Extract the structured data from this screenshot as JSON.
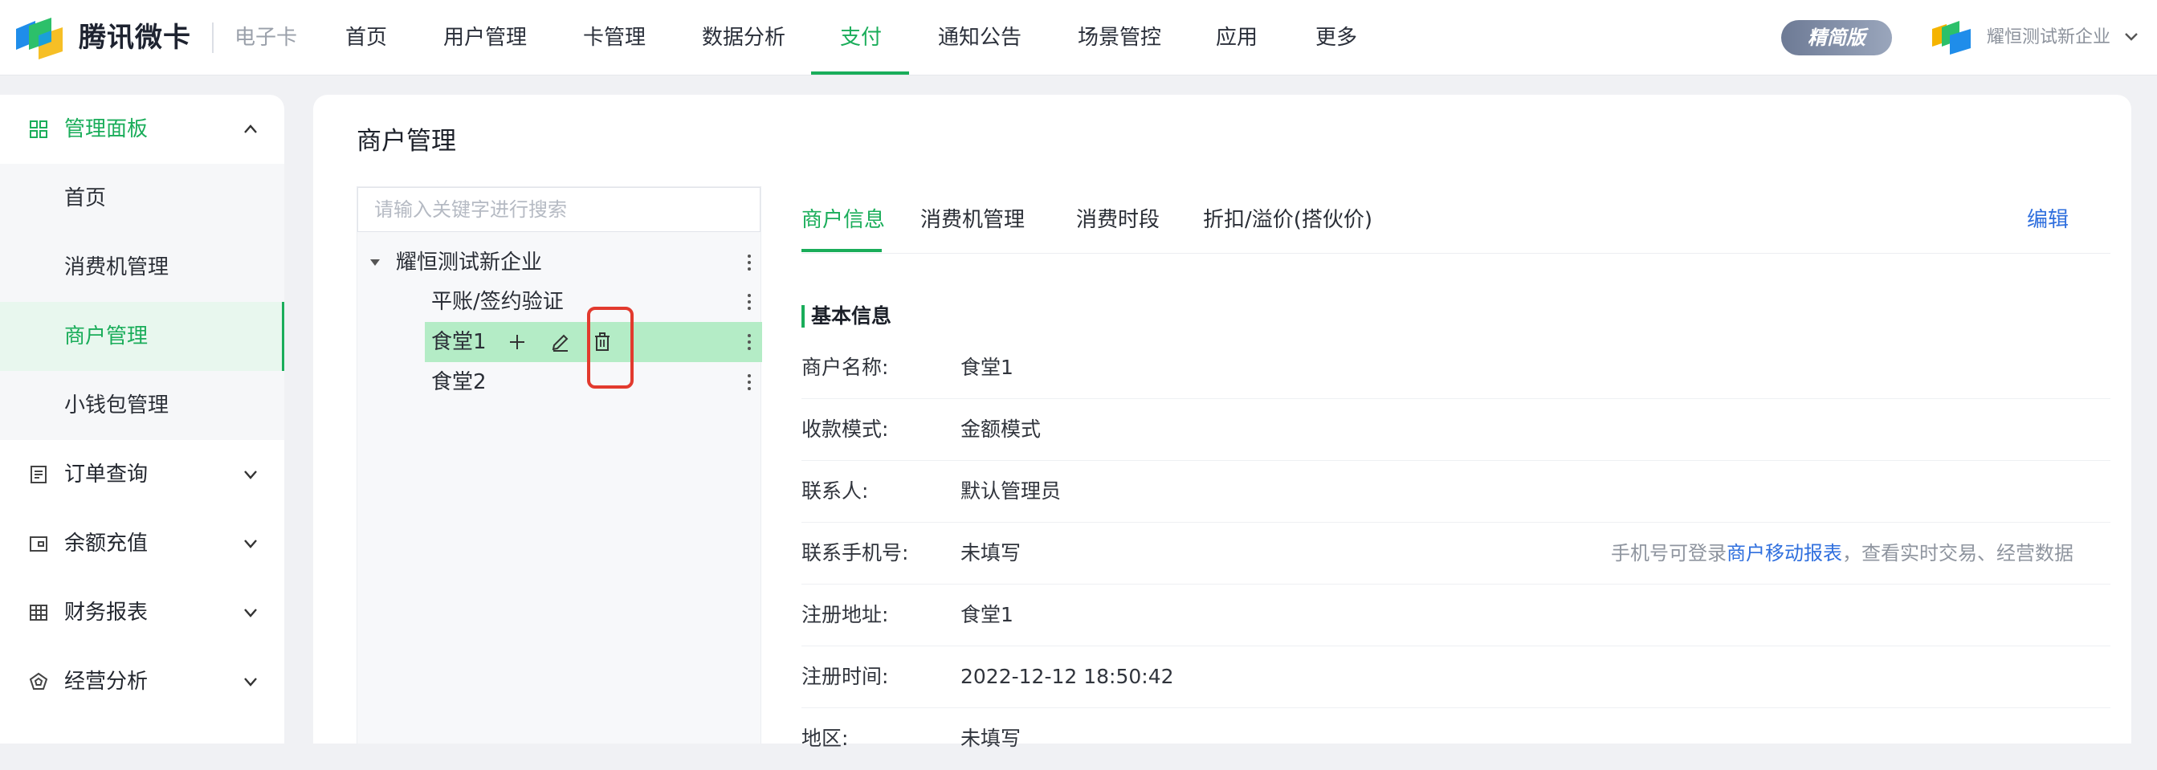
{
  "header": {
    "brand": "腾讯微卡",
    "product": "电子卡",
    "nav": [
      {
        "label": "首页"
      },
      {
        "label": "用户管理"
      },
      {
        "label": "卡管理"
      },
      {
        "label": "数据分析"
      },
      {
        "label": "支付"
      },
      {
        "label": "通知公告"
      },
      {
        "label": "场景管控"
      },
      {
        "label": "应用"
      },
      {
        "label": "更多"
      }
    ],
    "active_nav": "支付",
    "edition_badge": "精简版",
    "org_name": "耀恒测试新企业"
  },
  "sidebar": {
    "groups": [
      {
        "label": "管理面板",
        "icon": "dashboard-grid-icon",
        "expanded": true,
        "children": [
          {
            "label": "首页"
          },
          {
            "label": "消费机管理"
          },
          {
            "label": "商户管理",
            "active": true
          },
          {
            "label": "小钱包管理"
          }
        ]
      },
      {
        "label": "订单查询",
        "icon": "order-list-icon",
        "expanded": false
      },
      {
        "label": "余额充值",
        "icon": "wallet-icon",
        "expanded": false
      },
      {
        "label": "财务报表",
        "icon": "table-icon",
        "expanded": false
      },
      {
        "label": "经营分析",
        "icon": "analysis-icon",
        "expanded": false
      }
    ]
  },
  "main": {
    "title": "商户管理",
    "search": {
      "placeholder": "请输入关键字进行搜索",
      "value": ""
    },
    "tree": {
      "root": "耀恒测试新企业",
      "children": [
        {
          "label": "平账/签约验证"
        },
        {
          "label": "食堂1",
          "selected": true
        },
        {
          "label": "食堂2"
        }
      ]
    },
    "tabs": [
      {
        "label": "商户信息",
        "active": true
      },
      {
        "label": "消费机管理"
      },
      {
        "label": "消费时段"
      },
      {
        "label": "折扣/溢价(搭伙价)"
      }
    ],
    "edit_label": "编辑",
    "section_title": "基本信息",
    "fields": [
      {
        "label": "商户名称:",
        "value": "食堂1"
      },
      {
        "label": "收款模式:",
        "value": "金额模式"
      },
      {
        "label": "联系人:",
        "value": "默认管理员"
      },
      {
        "label": "联系手机号:",
        "value": "未填写"
      },
      {
        "label": "注册地址:",
        "value": "食堂1"
      },
      {
        "label": "注册时间:",
        "value": "2022-12-12 18:50:42"
      },
      {
        "label": "地区:",
        "value": "未填写"
      }
    ],
    "phone_hint": {
      "prefix": "手机号可登录",
      "link": "商户移动报表",
      "suffix": "，查看实时交易、经营数据"
    }
  },
  "colors": {
    "accent": "#1aad5a",
    "link": "#2f6fde",
    "selected_row": "#b4ecc6",
    "highlight_box": "#e23a2e"
  }
}
